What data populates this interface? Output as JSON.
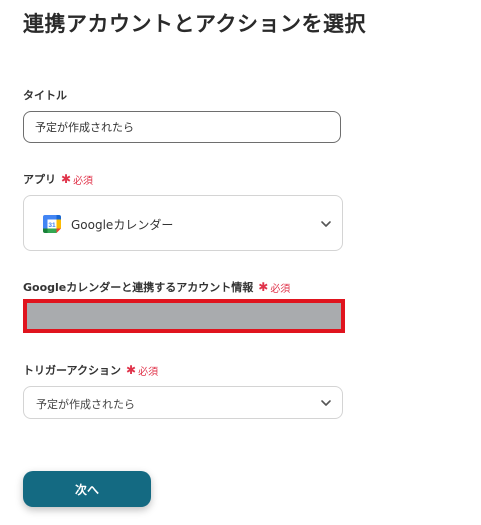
{
  "page": {
    "title": "連携アカウントとアクションを選択"
  },
  "title_field": {
    "label": "タイトル",
    "value": "予定が作成されたら"
  },
  "app_field": {
    "label": "アプリ",
    "required": "必須",
    "selected_app": "Googleカレンダー",
    "icon": "google-calendar-icon"
  },
  "account_field": {
    "label": "Googleカレンダーと連携するアカウント情報",
    "required": "必須",
    "value": ""
  },
  "trigger_field": {
    "label": "トリガーアクション",
    "required": "必須",
    "selected": "予定が作成されたら"
  },
  "actions": {
    "next_label": "次へ"
  },
  "colors": {
    "primary_button": "#146a82",
    "required_text": "#e0334a",
    "highlight_border": "#e0141e",
    "masked_field": "#a9abae"
  }
}
